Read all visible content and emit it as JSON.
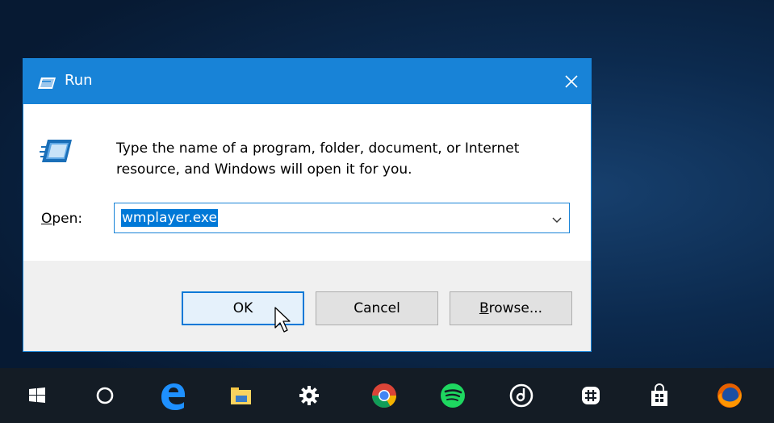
{
  "dialog": {
    "title": "Run",
    "description": "Type the name of a program, folder, document, or Internet resource, and Windows will open it for you.",
    "open_label_underlined": "O",
    "open_label_rest": "pen:",
    "combo_value": "wmplayer.exe",
    "buttons": {
      "ok": "OK",
      "cancel": "Cancel",
      "browse_underlined": "B",
      "browse_rest": "rowse..."
    }
  },
  "taskbar": {
    "items": [
      "start-icon",
      "cortana-icon",
      "edge-icon",
      "file-explorer-icon",
      "settings-icon",
      "chrome-icon",
      "spotify-icon",
      "groove-music-icon",
      "slack-icon",
      "store-icon",
      "firefox-icon"
    ]
  },
  "colors": {
    "titlebar": "#1883d7",
    "selection": "#0078d7",
    "taskbar": "#141c25",
    "footer": "#f0f0f0"
  }
}
